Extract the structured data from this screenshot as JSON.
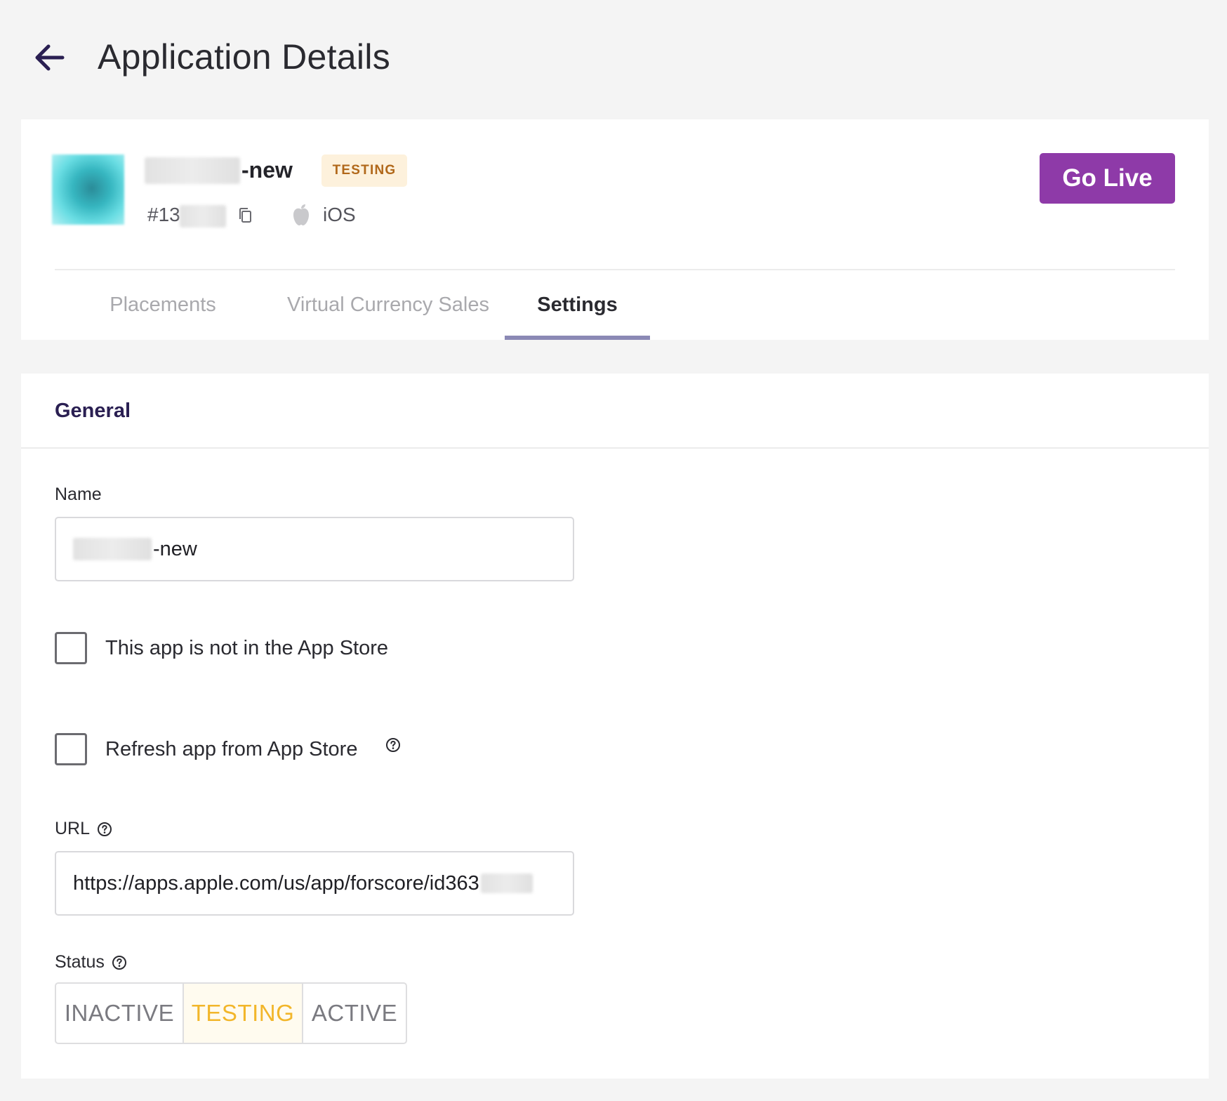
{
  "header": {
    "title": "Application Details",
    "back_icon": "arrow-left-icon"
  },
  "app": {
    "name_suffix": "-new",
    "status_badge": "TESTING",
    "id_prefix": "#13",
    "platform": "iOS",
    "platform_icon": "apple-icon",
    "copy_icon": "copy-icon",
    "go_live_label": "Go Live"
  },
  "tabs": [
    {
      "label": "Placements"
    },
    {
      "label": "Virtual Currency Sales"
    },
    {
      "label": "Settings"
    }
  ],
  "active_tab": "Settings",
  "settings": {
    "section_title": "General",
    "name_label": "Name",
    "name_value_suffix": "-new",
    "not_in_store_label": "This app is not in the App Store",
    "not_in_store_checked": false,
    "refresh_label": "Refresh app from App Store",
    "refresh_checked": false,
    "url_label": "URL",
    "url_value": "https://apps.apple.com/us/app/forscore/id363",
    "status_label": "Status",
    "status_options": [
      "INACTIVE",
      "TESTING",
      "ACTIVE"
    ],
    "status_selected": "TESTING"
  },
  "colors": {
    "accent": "#8e3aa8",
    "badge_bg": "#fdf1dc",
    "badge_text": "#b1681a",
    "tab_indicator": "#8b89b5",
    "status_selected": "#f2b62a"
  }
}
